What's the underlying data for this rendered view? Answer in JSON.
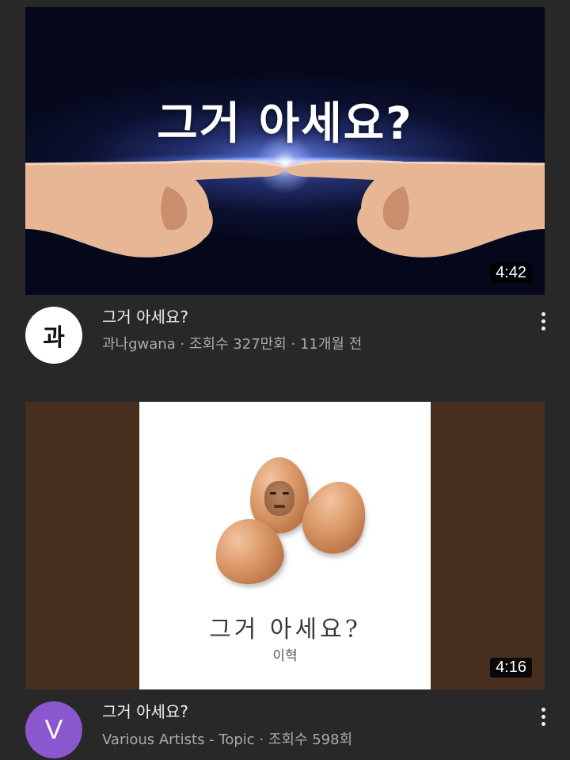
{
  "videos": [
    {
      "thumbnail_text": "그거 아세요?",
      "duration": "4:42",
      "avatar_text": "과",
      "title": "그거 아세요?",
      "subtitle": "과나gwana · 조회수 327만회 · 11개월 전"
    },
    {
      "cover_title": "그거 아세요?",
      "cover_artist": "이혁",
      "duration": "4:16",
      "avatar_text": "V",
      "title": "그거 아세요?",
      "subtitle": "Various Artists - Topic · 조회수 598회"
    }
  ],
  "icons": {
    "more": "more-vert-icon"
  },
  "colors": {
    "background": "#282828",
    "title_text": "#f1f1f1",
    "secondary_text": "#aaaaaa",
    "avatar_2": "#8b57cf",
    "album_bg": "#472f1f"
  }
}
